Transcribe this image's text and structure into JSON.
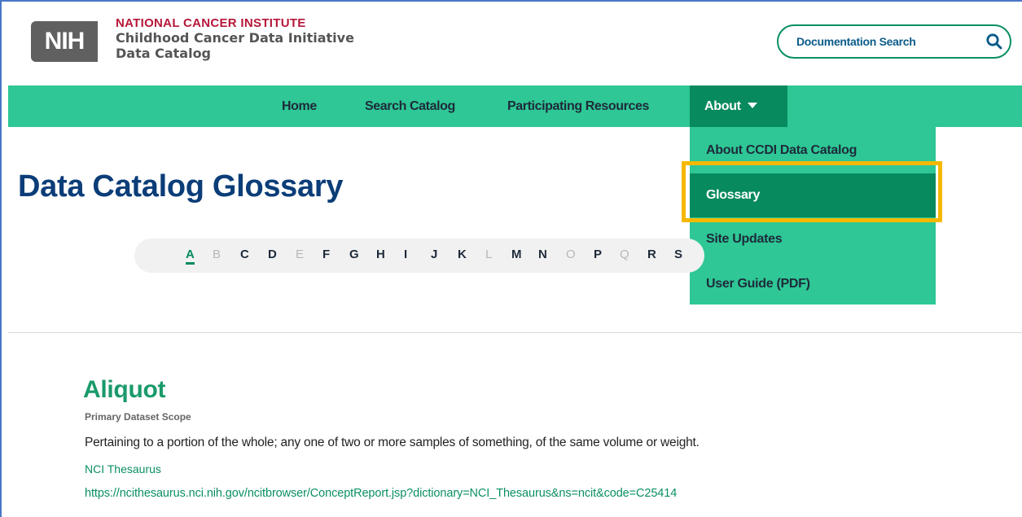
{
  "header": {
    "logo_text": "NIH",
    "institute": "NATIONAL CANCER INSTITUTE",
    "site_title_line1": "Childhood Cancer Data Initiative",
    "site_title_line2": "Data Catalog",
    "doc_search_label": "Documentation Search",
    "colors": {
      "institute": "#b5173a",
      "nih_gray": "#606060"
    }
  },
  "nav": {
    "items": [
      {
        "label": "Home"
      },
      {
        "label": "Search Catalog"
      },
      {
        "label": "Participating Resources"
      }
    ],
    "about_label": "About",
    "colors": {
      "bar": "#2ec795",
      "active": "#078a5e"
    }
  },
  "dropdown": {
    "items": [
      {
        "label": "About CCDI Data Catalog",
        "active": false
      },
      {
        "label": "Glossary",
        "active": true
      },
      {
        "label": "Site Updates",
        "active": false
      },
      {
        "label": "User Guide (PDF)",
        "active": false
      }
    ],
    "highlight_color": "#f5b800"
  },
  "page": {
    "title": "Data Catalog Glossary"
  },
  "alphabet": {
    "letters": [
      {
        "letter": "A",
        "state": "active"
      },
      {
        "letter": "B",
        "state": "disabled"
      },
      {
        "letter": "C",
        "state": "enabled"
      },
      {
        "letter": "D",
        "state": "enabled"
      },
      {
        "letter": "E",
        "state": "disabled"
      },
      {
        "letter": "F",
        "state": "enabled"
      },
      {
        "letter": "G",
        "state": "enabled"
      },
      {
        "letter": "H",
        "state": "enabled"
      },
      {
        "letter": "I",
        "state": "enabled"
      },
      {
        "letter": "J",
        "state": "enabled"
      },
      {
        "letter": "K",
        "state": "enabled"
      },
      {
        "letter": "L",
        "state": "disabled"
      },
      {
        "letter": "M",
        "state": "enabled"
      },
      {
        "letter": "N",
        "state": "enabled"
      },
      {
        "letter": "O",
        "state": "disabled"
      },
      {
        "letter": "P",
        "state": "enabled"
      },
      {
        "letter": "Q",
        "state": "disabled"
      },
      {
        "letter": "R",
        "state": "enabled"
      },
      {
        "letter": "S",
        "state": "enabled"
      }
    ]
  },
  "entry": {
    "term": "Aliquot",
    "scope": "Primary Dataset Scope",
    "definition": "Pertaining to a portion of the whole; any one of two or more samples of something, of the same volume or weight.",
    "source_name": "NCI Thesaurus",
    "source_url": "https://ncithesaurus.nci.nih.gov/ncitbrowser/ConceptReport.jsp?dictionary=NCI_Thesaurus&ns=ncit&code=C25414"
  }
}
